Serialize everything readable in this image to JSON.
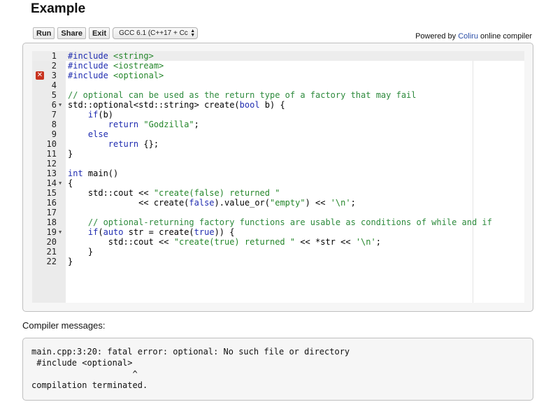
{
  "page": {
    "title": "Example"
  },
  "toolbar": {
    "run_label": "Run",
    "share_label": "Share",
    "exit_label": "Exit",
    "compiler_select": "GCC 6.1 (C++17 + Cc",
    "powered_prefix": "Powered by",
    "powered_link": "Coliru",
    "powered_suffix": "online compiler"
  },
  "editor": {
    "lines": [
      {
        "n": "1",
        "code": "#include <string>"
      },
      {
        "n": "2",
        "code": "#include <iostream>"
      },
      {
        "n": "3",
        "code": "#include <optional>",
        "error": true
      },
      {
        "n": "4",
        "code": ""
      },
      {
        "n": "5",
        "code": "// optional can be used as the return type of a factory that may fail"
      },
      {
        "n": "6",
        "code": "std::optional<std::string> create(bool b) {",
        "fold": true
      },
      {
        "n": "7",
        "code": "    if(b)"
      },
      {
        "n": "8",
        "code": "        return \"Godzilla\";"
      },
      {
        "n": "9",
        "code": "    else"
      },
      {
        "n": "10",
        "code": "        return {};"
      },
      {
        "n": "11",
        "code": "}"
      },
      {
        "n": "12",
        "code": ""
      },
      {
        "n": "13",
        "code": "int main()"
      },
      {
        "n": "14",
        "code": "{",
        "fold": true
      },
      {
        "n": "15",
        "code": "    std::cout << \"create(false) returned \""
      },
      {
        "n": "16",
        "code": "              << create(false).value_or(\"empty\") << '\\n';"
      },
      {
        "n": "17",
        "code": ""
      },
      {
        "n": "18",
        "code": "    // optional-returning factory functions are usable as conditions of while and if"
      },
      {
        "n": "19",
        "code": "    if(auto str = create(true)) {",
        "fold": true
      },
      {
        "n": "20",
        "code": "        std::cout << \"create(true) returned \" << *str << '\\n';"
      },
      {
        "n": "21",
        "code": "    }"
      },
      {
        "n": "22",
        "code": "}"
      }
    ],
    "error_marker": "✕",
    "fold_marker": "▼"
  },
  "messages": {
    "label": "Compiler messages:",
    "text": "main.cpp:3:20: fatal error: optional: No such file or directory\n #include <optional>\n                    ^\ncompilation terminated."
  }
}
